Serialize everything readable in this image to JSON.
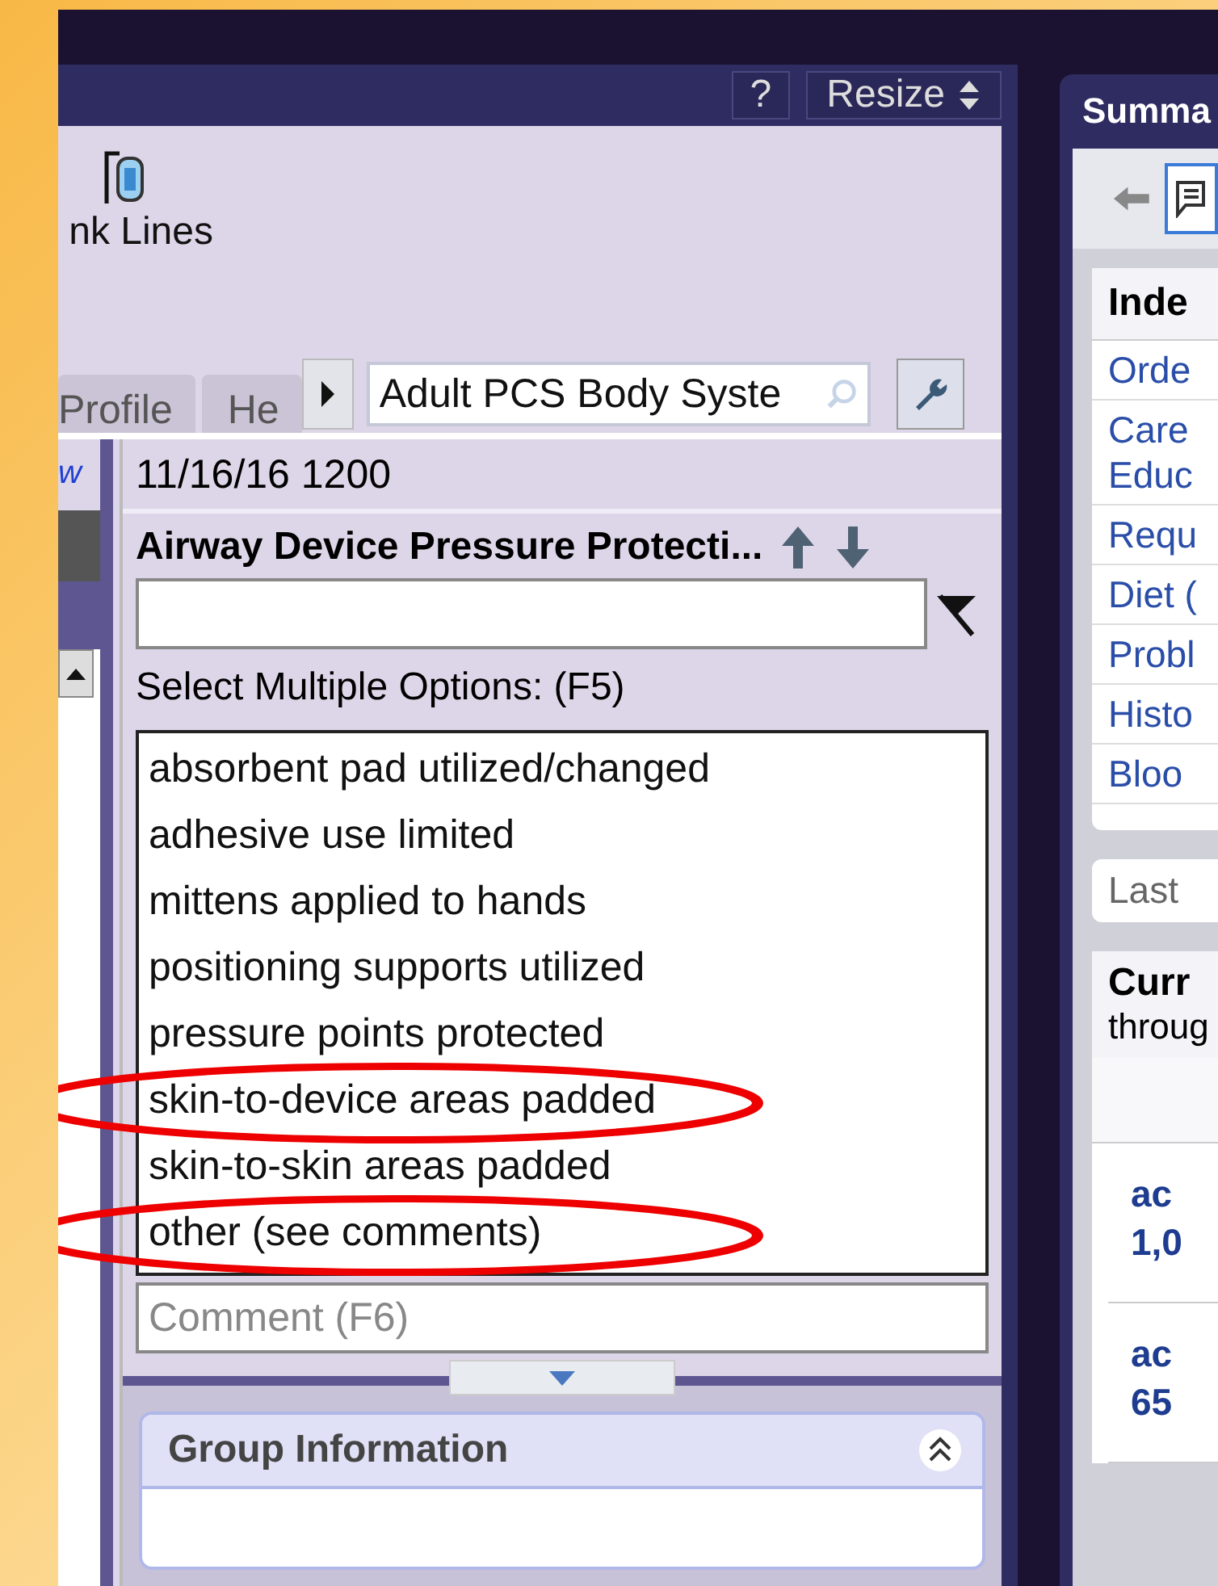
{
  "left_panel": {
    "help_button": "?",
    "resize_button": "Resize",
    "toolbar_label": "nk Lines",
    "tabs": [
      {
        "label": "Profile",
        "selected": false
      },
      {
        "label": "He",
        "selected": false
      }
    ],
    "search": {
      "value": "Adult PCS Body Syste"
    },
    "side_link": "w"
  },
  "form": {
    "timestamp": "11/16/16 1200",
    "title": "Airway Device Pressure Protecti...",
    "instruction": "Select Multiple Options: (F5)",
    "options": [
      {
        "label": "absorbent pad utilized/changed",
        "circled": false
      },
      {
        "label": "adhesive use limited",
        "circled": false
      },
      {
        "label": "mittens applied to hands",
        "circled": false
      },
      {
        "label": "positioning supports utilized",
        "circled": false
      },
      {
        "label": "pressure points protected",
        "circled": false
      },
      {
        "label": "skin-to-device areas padded",
        "circled": true
      },
      {
        "label": "skin-to-skin areas padded",
        "circled": false
      },
      {
        "label": "other (see comments)",
        "circled": true
      }
    ],
    "comment": {
      "placeholder": "Comment (F6)"
    },
    "group": {
      "title": "Group Information",
      "expanded": true
    }
  },
  "right_panel": {
    "tab": "Summa",
    "index": {
      "title": "Inde",
      "links": [
        "Orde",
        "Care\nEduc",
        "Requ",
        "Diet (",
        "Probl",
        "Histo",
        "Bloo"
      ]
    },
    "last": "Last",
    "current": {
      "title": "Curr",
      "subtitle": "throug"
    },
    "entries": [
      {
        "line1": "ac",
        "line2": "1,0"
      },
      {
        "line1": "ac",
        "line2": "65"
      }
    ]
  }
}
